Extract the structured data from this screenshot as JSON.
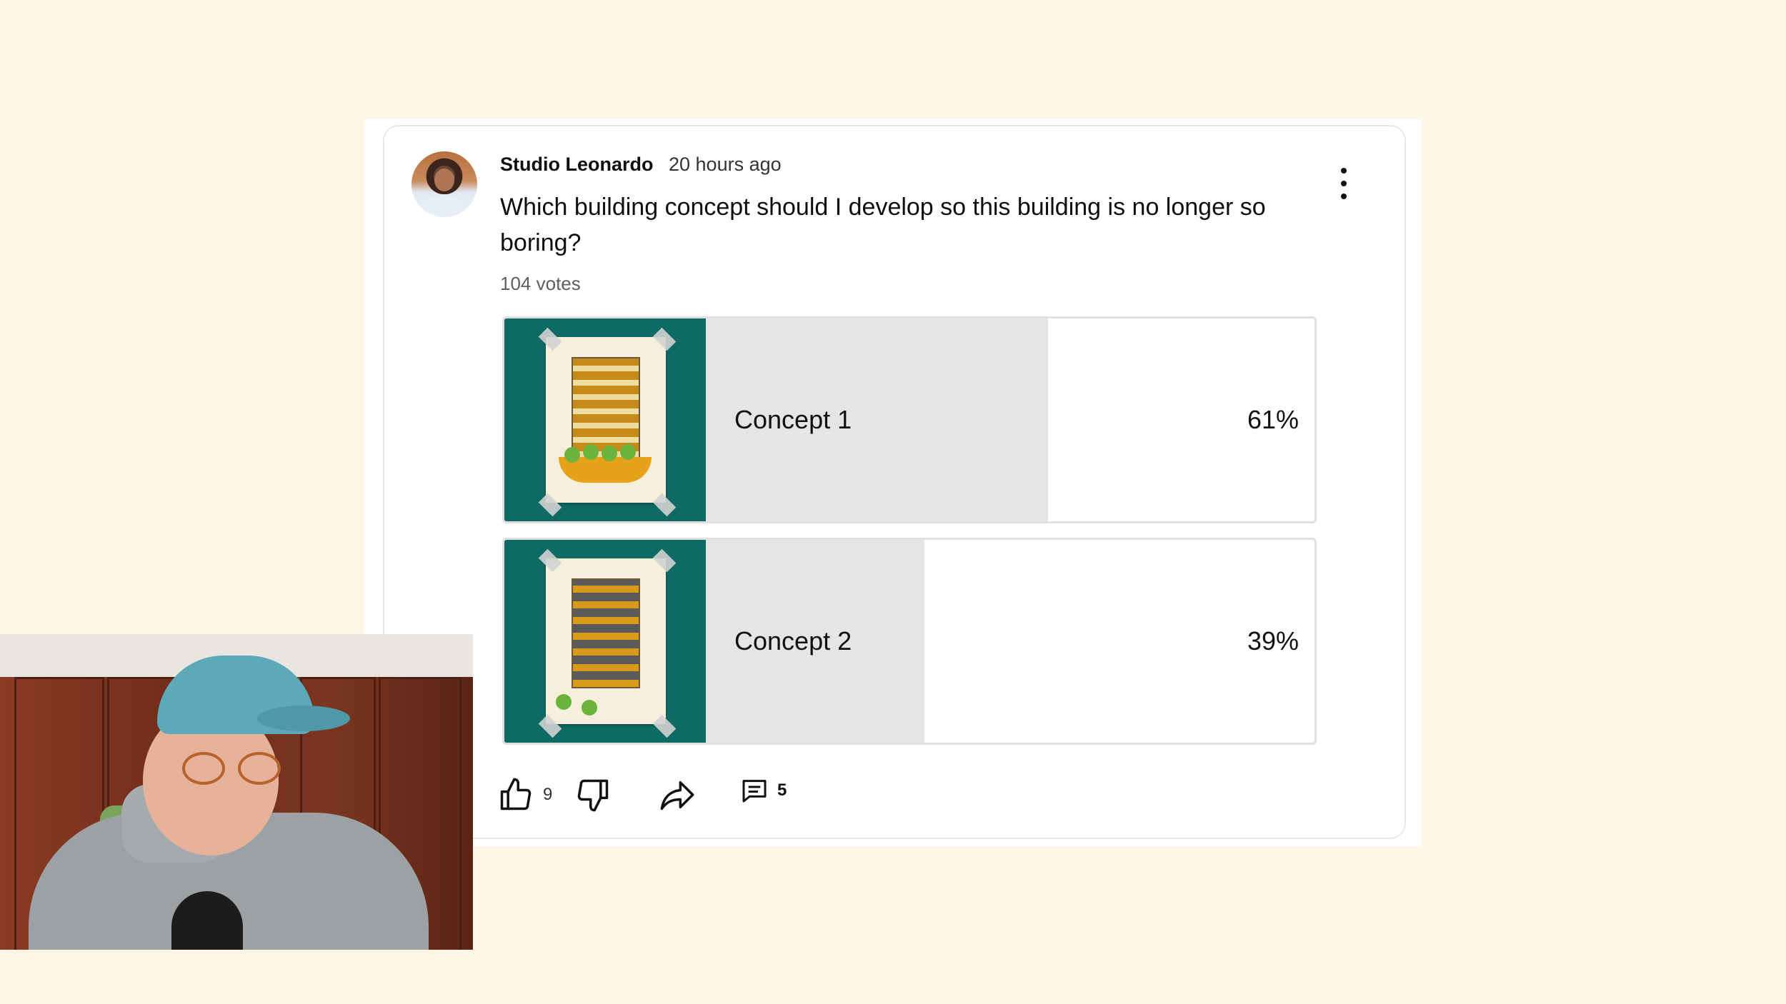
{
  "post": {
    "author": "Studio Leonardo",
    "time": "20 hours ago",
    "question": "Which building concept should I develop so this building is no longer so boring?",
    "votes": "104 votes",
    "menu_icon": "more-vert-icon"
  },
  "poll": {
    "options": [
      {
        "label": "Concept 1",
        "percent_text": "61%",
        "percent": 61
      },
      {
        "label": "Concept 2",
        "percent_text": "39%",
        "percent": 39
      }
    ]
  },
  "actions": {
    "like_count": "9",
    "comment_count": "5",
    "icons": [
      "thumb-up-icon",
      "thumb-down-icon",
      "share-icon",
      "comment-icon"
    ]
  },
  "colors": {
    "background": "#fff6e5",
    "bar_fill": "#e5e5e5",
    "thumbnail_bg": "#0e6b63"
  }
}
